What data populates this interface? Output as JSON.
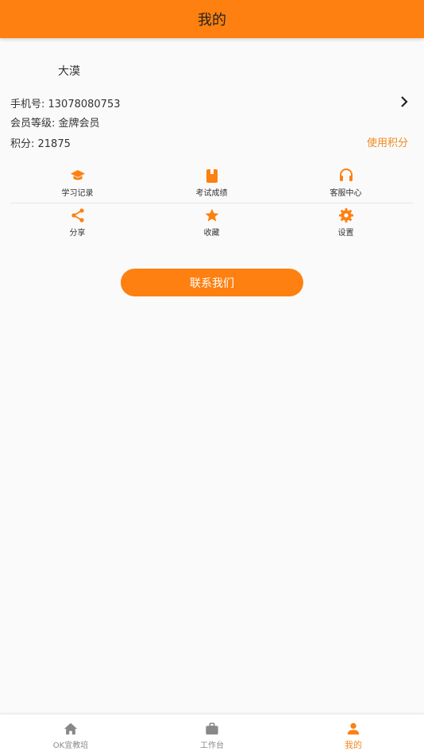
{
  "header": {
    "title": "我的"
  },
  "profile": {
    "username": "大漠",
    "phone": "手机号: 13078080753",
    "level": "会员等级: 金牌会员",
    "points": "积分: 21875",
    "use_points": "使用积分"
  },
  "menu_row1": [
    {
      "label": "学习记录",
      "icon": "graduation-cap-icon"
    },
    {
      "label": "考试成绩",
      "icon": "book-icon"
    },
    {
      "label": "客服中心",
      "icon": "headset-icon"
    }
  ],
  "menu_row2": [
    {
      "label": "分享",
      "icon": "share-icon"
    },
    {
      "label": "收藏",
      "icon": "star-icon"
    },
    {
      "label": "设置",
      "icon": "gear-icon"
    }
  ],
  "contact_button": "联系我们",
  "tabs": [
    {
      "label": "OK宜教培",
      "icon": "home-icon"
    },
    {
      "label": "工作台",
      "icon": "briefcase-icon"
    },
    {
      "label": "我的",
      "icon": "person-icon"
    }
  ],
  "colors": {
    "accent": "#fe8010",
    "accent_text": "#f0891f",
    "tab_inactive": "#888888"
  }
}
